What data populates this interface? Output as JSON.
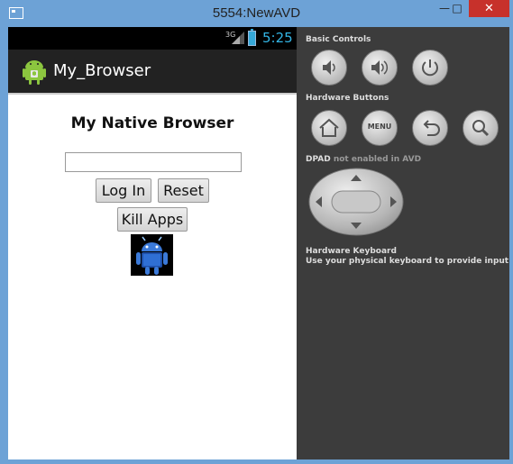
{
  "window": {
    "title": "5554:NewAVD",
    "minimize_glyph": "—",
    "restore_glyph": "□",
    "close_glyph": "✕",
    "accent": "#6da2d6",
    "close_color": "#c7312b"
  },
  "statusbar": {
    "network": "3G",
    "time": "5:25",
    "time_color": "#33b5e5"
  },
  "actionbar": {
    "icon": "android-app-icon",
    "title": "My_Browser"
  },
  "page": {
    "heading": "My Native Browser",
    "url_input_value": "",
    "login_label": "Log In",
    "reset_label": "Reset",
    "kill_label": "Kill Apps",
    "image": "android-robot-image"
  },
  "panel": {
    "basic_controls": "Basic Controls",
    "hardware_buttons": "Hardware Buttons",
    "dpad_label": "DPAD",
    "dpad_note": "not enabled in AVD",
    "keyboard_title": "Hardware Keyboard",
    "keyboard_note": "Use your physical keyboard to provide input",
    "menu_label": "MENU",
    "basic_icons": [
      "volume-down-icon",
      "volume-up-icon",
      "power-icon"
    ],
    "hardware_icons": [
      "home-icon",
      "menu-icon",
      "back-icon",
      "search-icon"
    ]
  }
}
